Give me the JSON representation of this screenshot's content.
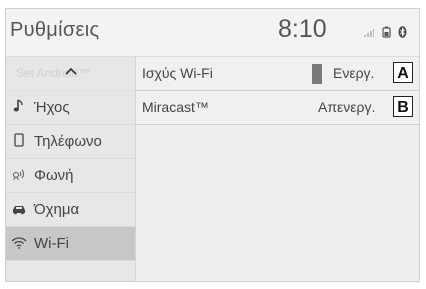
{
  "header": {
    "title": "Ρυθμίσεις",
    "time": "8:10"
  },
  "sidebar": {
    "faded_item": "Set Android™",
    "items": [
      {
        "icon": "music-note-icon",
        "label": "Ήχος"
      },
      {
        "icon": "phone-icon",
        "label": "Τηλέφωνο"
      },
      {
        "icon": "voice-icon",
        "label": "Φωνή"
      },
      {
        "icon": "car-icon",
        "label": "Όχημα"
      },
      {
        "icon": "wifi-icon",
        "label": "Wi-Fi",
        "selected": true
      }
    ]
  },
  "main": {
    "rows": [
      {
        "label": "Ισχύς Wi-Fi",
        "status": "Ενεργ.",
        "callout": "A"
      },
      {
        "label": "Miracast™",
        "status": "Απενεργ.",
        "callout": "B"
      }
    ]
  },
  "colors": {
    "selected_bg": "#c7c7c7",
    "toggle_on": "#7a7a7a"
  }
}
